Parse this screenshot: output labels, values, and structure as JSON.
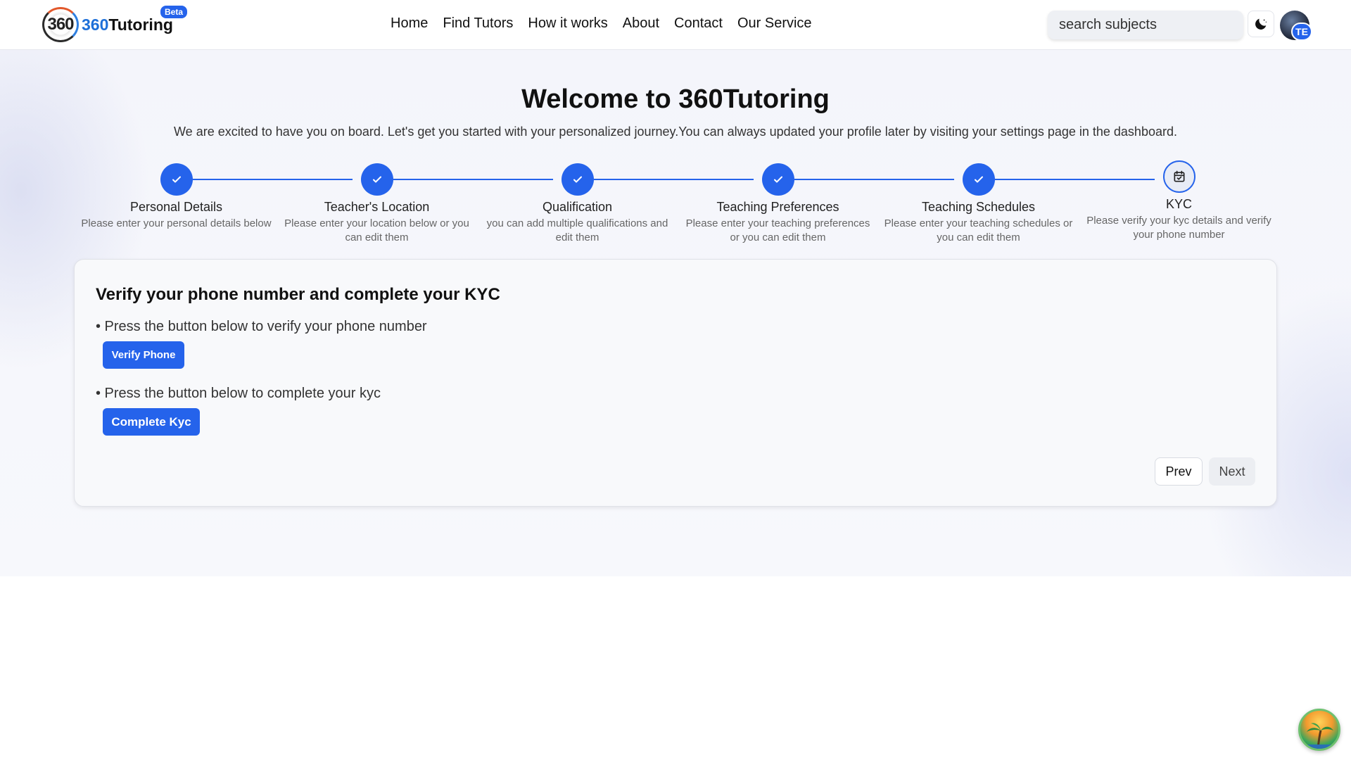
{
  "header": {
    "logo_mark": "360",
    "logo_text_num": "360",
    "logo_text_word": "Tutoring",
    "beta": "Beta",
    "nav": [
      "Home",
      "Find Tutors",
      "How it works",
      "About",
      "Contact",
      "Our Service"
    ],
    "search_placeholder": "search subjects",
    "avatar_initials": "TE",
    "icons": {
      "theme": "moon-icon",
      "avatar": "user-avatar"
    }
  },
  "page": {
    "title": "Welcome to 360Tutoring",
    "subtitle": "We are excited to have you on board. Let's get you started with your personalized journey.You can always updated your profile later by visiting your settings page in the dashboard."
  },
  "steps": [
    {
      "label": "Personal Details",
      "desc": "Please enter your personal details below",
      "status": "complete"
    },
    {
      "label": "Teacher's Location",
      "desc": "Please enter your location below or you can edit them",
      "status": "complete"
    },
    {
      "label": "Qualification",
      "desc": "you can add multiple qualifications and edit them",
      "status": "complete"
    },
    {
      "label": "Teaching Preferences",
      "desc": "Please enter your teaching preferences or you can edit them",
      "status": "complete"
    },
    {
      "label": "Teaching Schedules",
      "desc": "Please enter your teaching schedules or you can edit them",
      "status": "complete"
    },
    {
      "label": "KYC",
      "desc": "Please verify your kyc details and verify your phone number",
      "status": "current"
    }
  ],
  "card": {
    "title": "Verify your phone number and complete your KYC",
    "phone_instruction": "• Press the button below to verify your phone number",
    "verify_phone_label": "Verify Phone",
    "kyc_instruction": "• Press the button below to complete your kyc",
    "complete_kyc_label": "Complete Kyc",
    "prev_label": "Prev",
    "next_label": "Next"
  },
  "colors": {
    "accent": "#2563eb",
    "text": "#111111",
    "muted": "#666666"
  }
}
